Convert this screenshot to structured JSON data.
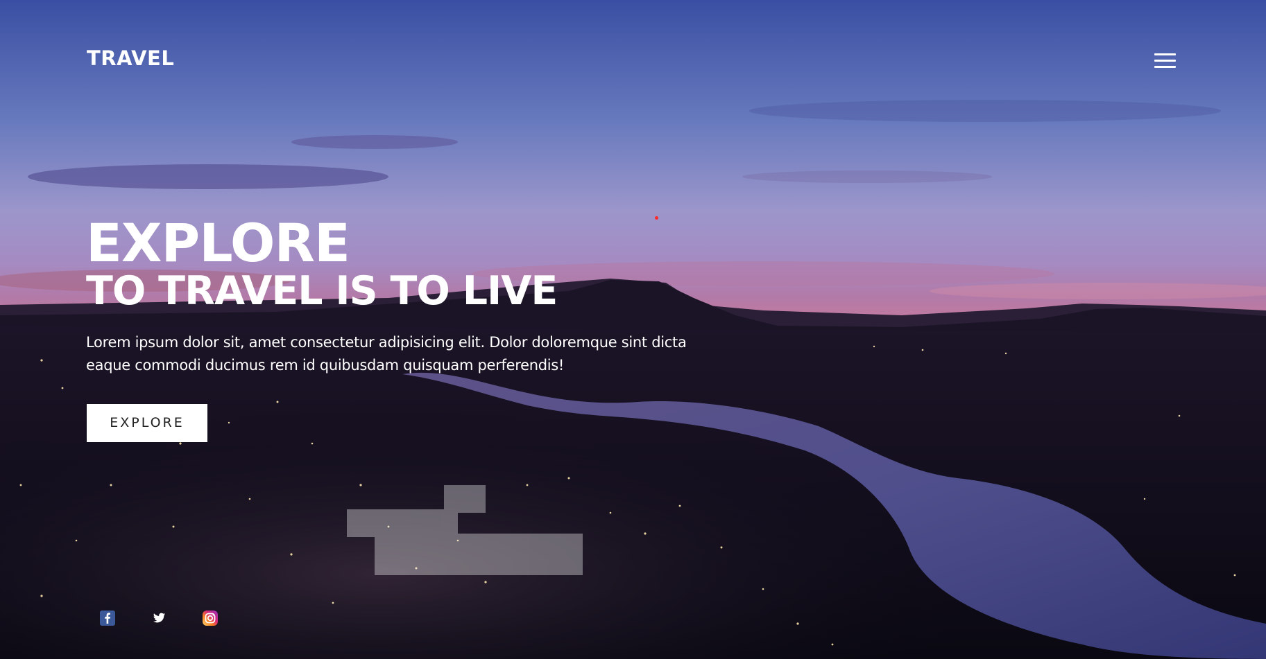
{
  "brand": {
    "logo_text": "TRAVEL"
  },
  "nav": {
    "menu_icon": "hamburger-menu-icon"
  },
  "hero": {
    "title": "EXPLORE",
    "subtitle": "TO TRAVEL IS TO LIVE",
    "description": "Lorem ipsum dolor sit, amet consectetur adipisicing elit. Dolor doloremque sint dicta eaque commodi ducimus rem id quibusdam quisquam perferendis!",
    "cta_label": "EXPLORE",
    "background": "aerial-city-river-dusk-photo"
  },
  "socials": [
    {
      "icon": "facebook-icon",
      "color": "#3b5998"
    },
    {
      "icon": "twitter-icon",
      "color": "#ffffff"
    },
    {
      "icon": "instagram-icon",
      "color": "#e1306c"
    }
  ],
  "colors": {
    "text": "#ffffff",
    "button_bg": "#ffffff",
    "button_text": "#222222",
    "sky_top": "#3e55a8",
    "sky_mid": "#8f8ec7",
    "horizon": "#c57aa6",
    "ground": "#0c0a1a"
  }
}
